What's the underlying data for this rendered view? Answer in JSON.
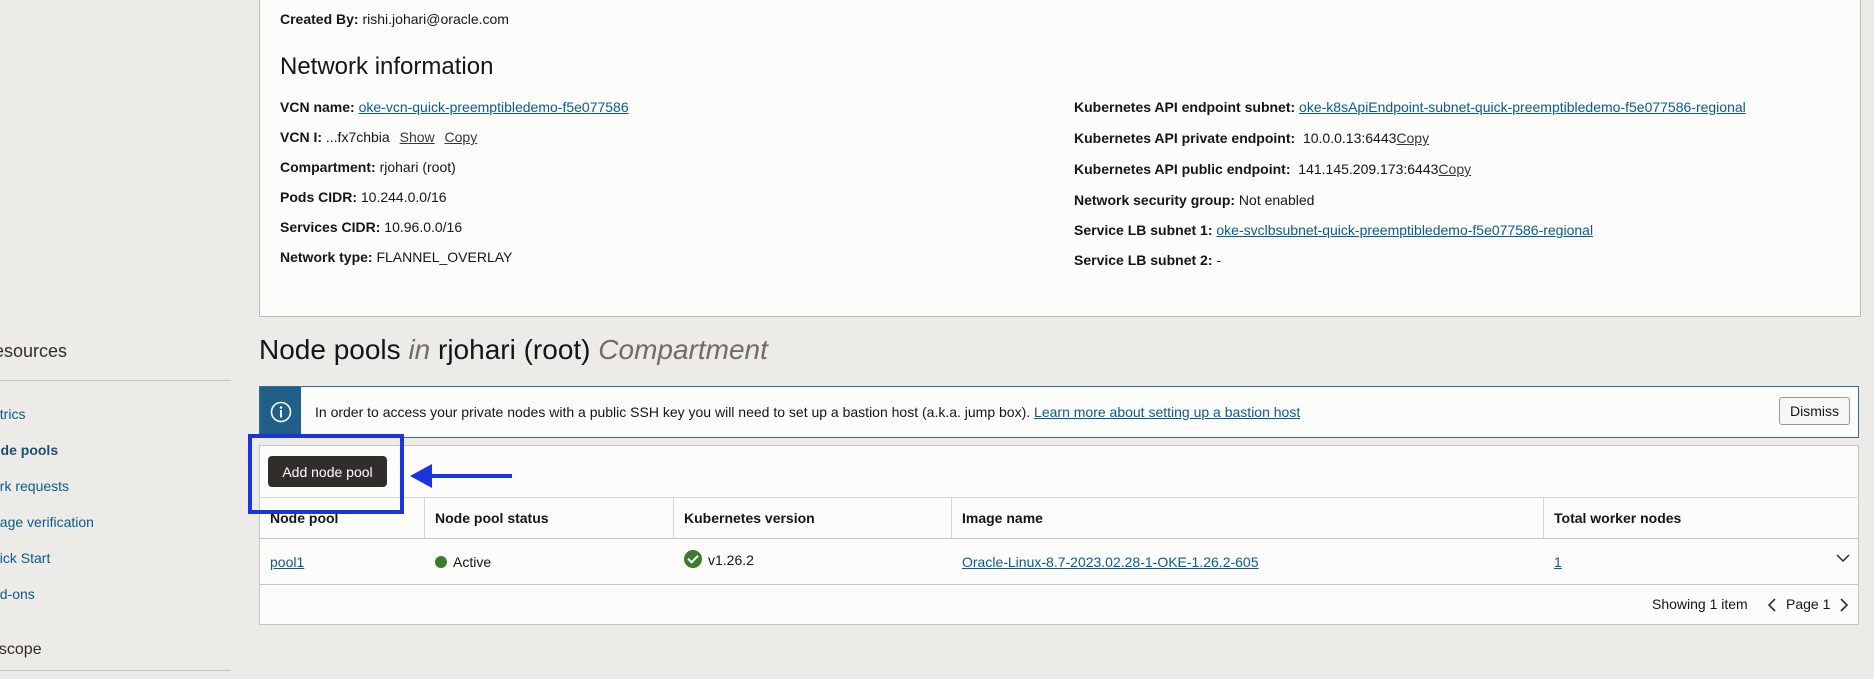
{
  "details": {
    "created_by_label": "Created By:",
    "created_by_value": "rishi.johari@oracle.com"
  },
  "network": {
    "title": "Network information",
    "vcn_name_label": "VCN name:",
    "vcn_name_value": "oke-vcn-quick-preemptibledemo-f5e077586",
    "vcn_id_label": "VCN I:",
    "vcn_id_value": "...fx7chbia",
    "show_label": "Show",
    "copy_label": "Copy",
    "compartment_label": "Compartment:",
    "compartment_value": "rjohari (root)",
    "pods_cidr_label": "Pods CIDR:",
    "pods_cidr_value": "10.244.0.0/16",
    "services_cidr_label": "Services CIDR:",
    "services_cidr_value": "10.96.0.0/16",
    "network_type_label": "Network type:",
    "network_type_value": "FLANNEL_OVERLAY",
    "api_subnet_label": "Kubernetes API endpoint subnet:",
    "api_subnet_value": "oke-k8sApiEndpoint-subnet-quick-preemptibledemo-f5e077586-regional",
    "api_private_label": "Kubernetes API private endpoint:",
    "api_private_value": "10.0.0.13:6443",
    "api_public_label": "Kubernetes API public endpoint:",
    "api_public_value": "141.145.209.173:6443",
    "nsg_label": "Network security group:",
    "nsg_value": "Not enabled",
    "lb1_label": "Service LB subnet 1:",
    "lb1_value": "oke-svclbsubnet-quick-preemptibledemo-f5e077586-regional",
    "lb2_label": "Service LB subnet 2:",
    "lb2_value": "-"
  },
  "sidebar": {
    "title": "esources",
    "items": [
      {
        "label": "etrics"
      },
      {
        "label": "ode pools"
      },
      {
        "label": "ork requests"
      },
      {
        "label": "nage verification"
      },
      {
        "label": "uick Start"
      },
      {
        "label": "dd-ons"
      }
    ],
    "scope_label": "t scope"
  },
  "node_pools": {
    "title_main": "Node pools",
    "title_in": "in",
    "title_compartment": "rjohari (root)",
    "title_suffix": "Compartment"
  },
  "banner": {
    "text": "In order to access your private nodes with a public SSH key you will need to set up a bastion host (a.k.a. jump box).",
    "link": "Learn more about setting up a bastion host",
    "dismiss_label": "Dismiss"
  },
  "toolbar": {
    "add_label": "Add node pool"
  },
  "table": {
    "headers": [
      "Node pool",
      "Node pool status",
      "Kubernetes version",
      "Image name",
      "Total worker nodes"
    ],
    "rows": [
      {
        "name": "pool1",
        "status": "Active",
        "k8s_version": "v1.26.2",
        "image": "Oracle-Linux-8.7-2023.02.28-1-OKE-1.26.2-605",
        "total_nodes": "1"
      }
    ]
  },
  "pagination": {
    "showing": "Showing 1 item",
    "page": "Page 1"
  },
  "colors": {
    "highlight": "#1a35e0",
    "active": "#3f7a2e",
    "link": "#0b5b8a"
  }
}
